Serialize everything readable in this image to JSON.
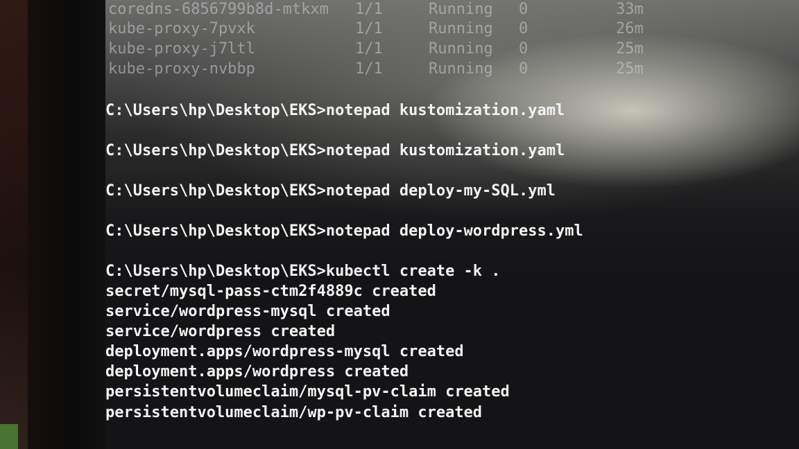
{
  "terminal": {
    "pods": [
      {
        "name": "coredns-6856799b8d-mtkxm",
        "ready": "1/1",
        "status": "Running",
        "restarts": "0",
        "age": "33m"
      },
      {
        "name": "kube-proxy-7pvxk",
        "ready": "1/1",
        "status": "Running",
        "restarts": "0",
        "age": "26m"
      },
      {
        "name": "kube-proxy-j7ltl",
        "ready": "1/1",
        "status": "Running",
        "restarts": "0",
        "age": "25m"
      },
      {
        "name": "kube-proxy-nvbbp",
        "ready": "1/1",
        "status": "Running",
        "restarts": "0",
        "age": "25m"
      }
    ],
    "commands": [
      "C:\\Users\\hp\\Desktop\\EKS>notepad kustomization.yaml",
      "C:\\Users\\hp\\Desktop\\EKS>notepad kustomization.yaml",
      "C:\\Users\\hp\\Desktop\\EKS>notepad deploy-my-SQL.yml",
      "C:\\Users\\hp\\Desktop\\EKS>notepad deploy-wordpress.yml",
      "C:\\Users\\hp\\Desktop\\EKS>kubectl create -k ."
    ],
    "output": [
      "secret/mysql-pass-ctm2f4889c created",
      "service/wordpress-mysql created",
      "service/wordpress created",
      "deployment.apps/wordpress-mysql created",
      "deployment.apps/wordpress created",
      "persistentvolumeclaim/mysql-pv-claim created",
      "persistentvolumeclaim/wp-pv-claim created"
    ]
  }
}
